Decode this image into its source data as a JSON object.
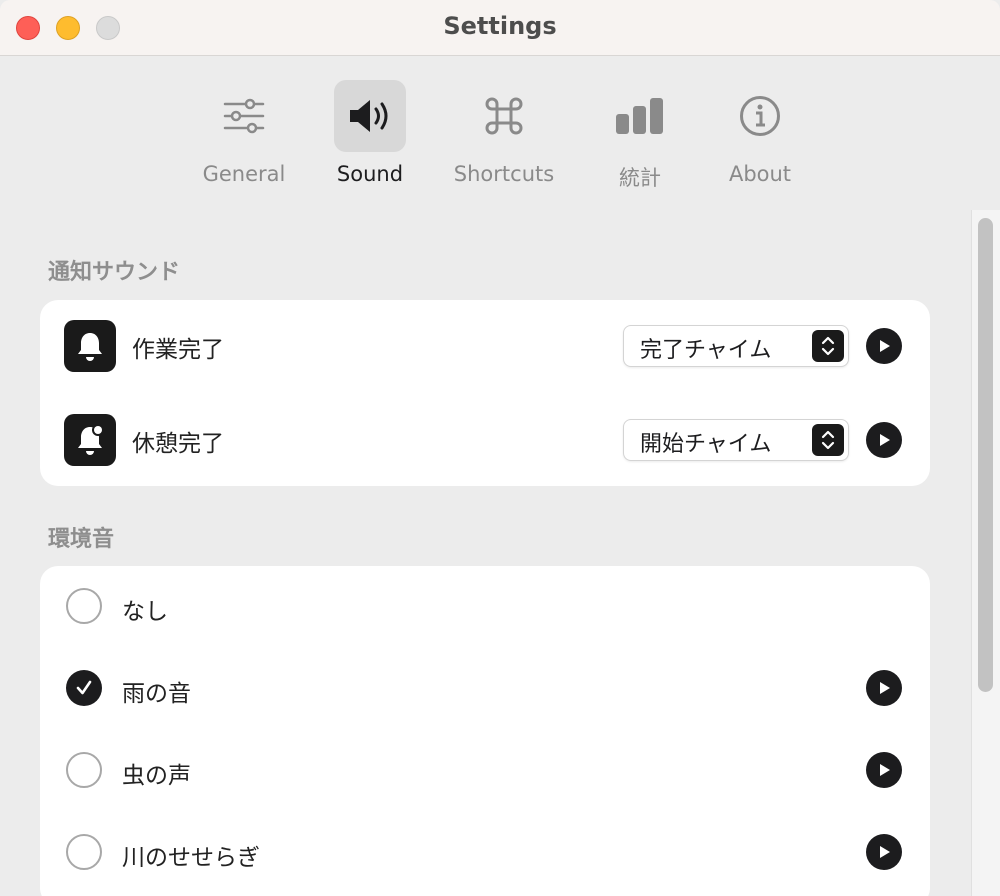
{
  "window": {
    "title": "Settings"
  },
  "tabs": [
    {
      "label": "General",
      "icon": "sliders-icon",
      "active": false
    },
    {
      "label": "Sound",
      "icon": "speaker-icon",
      "active": true
    },
    {
      "label": "Shortcuts",
      "icon": "command-icon",
      "active": false
    },
    {
      "label": "統計",
      "icon": "bar-chart-icon",
      "active": false
    },
    {
      "label": "About",
      "icon": "info-icon",
      "active": false
    }
  ],
  "notification_section": {
    "title": "通知サウンド",
    "rows": [
      {
        "label": "作業完了",
        "icon": "bell-icon",
        "selected_sound": "完了チャイム"
      },
      {
        "label": "休憩完了",
        "icon": "bell-badge-icon",
        "selected_sound": "開始チャイム"
      }
    ]
  },
  "ambient_section": {
    "title": "環境音",
    "options": [
      {
        "label": "なし",
        "checked": false,
        "playable": false
      },
      {
        "label": "雨の音",
        "checked": true,
        "playable": true
      },
      {
        "label": "虫の声",
        "checked": false,
        "playable": true
      },
      {
        "label": "川のせせらぎ",
        "checked": false,
        "playable": true
      }
    ]
  },
  "colors": {
    "accent_dark": "#1c1c1e",
    "close": "#fe5f57",
    "minimize": "#febc2e",
    "zoom_disabled": "#dcdcdc"
  }
}
